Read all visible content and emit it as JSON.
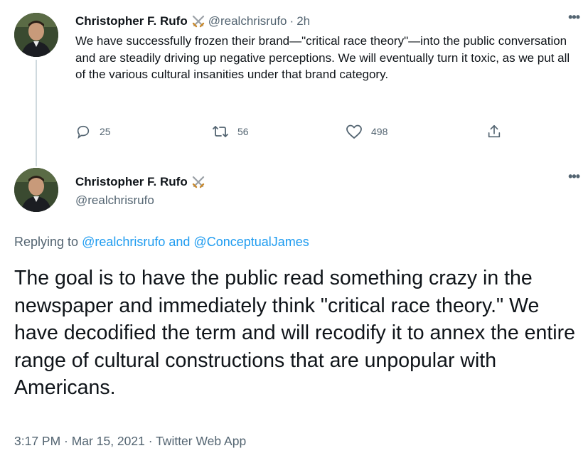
{
  "tweet1": {
    "author_name": "Christopher F. Rufo",
    "author_badge_icon": "crossed-swords-icon",
    "handle": "@realchrisrufo",
    "separator": "·",
    "time": "2h",
    "more_label": "•••",
    "text": "We have successfully frozen their brand—\"critical race theory\"—into the public conversation and are steadily driving up negative perceptions. We will eventually turn it toxic, as we put all of the various cultural insanities under that brand category.",
    "replies": "25",
    "retweets": "56",
    "likes": "498"
  },
  "tweet2": {
    "author_name": "Christopher F. Rufo",
    "author_badge_icon": "crossed-swords-icon",
    "handle": "@realchrisrufo",
    "more_label": "•••",
    "replying_prefix": "Replying to ",
    "replying_user1": "@realchrisrufo",
    "replying_and": " and ",
    "replying_user2": "@ConceptualJames",
    "text": "The goal is to have the public read something crazy in the newspaper and immediately think \"critical race theory.\" We have decodified the term and will recodify it to annex the entire range of cultural constructions that are unpopular with Americans.",
    "meta": "3:17 PM · Mar 15, 2021 · Twitter Web App"
  },
  "colors": {
    "text_primary": "#0f1419",
    "text_secondary": "#536471",
    "link": "#1d9bf0",
    "thread_line": "#cfd9de"
  }
}
